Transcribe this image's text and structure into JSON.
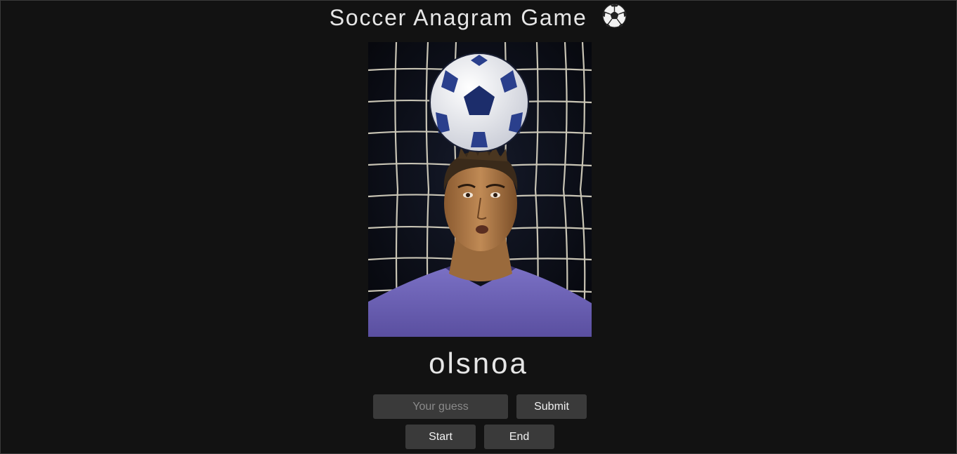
{
  "header": {
    "title": "Soccer Anagram Game",
    "title_icon": "soccer-ball-icon"
  },
  "player_photo": {
    "alt": "Player photo",
    "colors": {
      "background": "#0a0c14",
      "net": "#e8e4d6",
      "shirt": "#6f63b8",
      "skin": "#b07846",
      "hair": "#3a2a1a"
    }
  },
  "game": {
    "scrambled_word": "olsnoa"
  },
  "controls": {
    "guess_placeholder": "Your guess",
    "guess_value": "",
    "submit_label": "Submit",
    "start_label": "Start",
    "end_label": "End"
  },
  "theme": {
    "page_background": "#121212",
    "button_background": "#3a3a3a",
    "text_color": "#e6e6e6"
  }
}
